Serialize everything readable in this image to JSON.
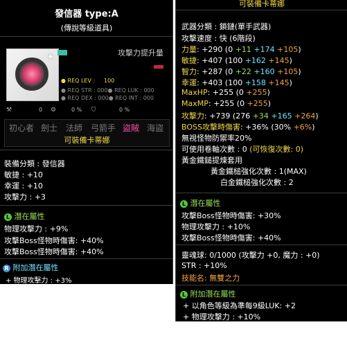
{
  "left": {
    "title": "發信器 type:A",
    "subtitle": "(傳說等級道具)",
    "attack_up": "攻擊力提升量",
    "req": {
      "lev_label": "● REQ LEV :",
      "lev_value": "100",
      "str": "● REQ STR : 000● REQ LUK : 000",
      "dex": "● REQ DEX : 000● REQ INT : 000"
    },
    "icon_row": [
      "0",
      "0 %",
      "0 %"
    ],
    "jobs": [
      "初心者",
      "劍士",
      "法師",
      "弓箭手",
      "盜賊",
      "海盜"
    ],
    "usable": "可裝備卡蒂娜",
    "stats": {
      "category": "裝備分類 : 發信器",
      "dex": "敏捷 : +10",
      "luk": "幸運 : +10",
      "atk": "攻擊力 : +3"
    },
    "potential": {
      "label": "潛在屬性",
      "lines": [
        "物理攻擊力 : +9%",
        "攻擊Boss怪物時傷害: +40%",
        "攻擊Boss怪物時傷害: +40%"
      ]
    },
    "additional": {
      "label": "附加潛在屬性",
      "lines": [
        "+ 物理攻擊力 : +3%"
      ]
    }
  },
  "right": {
    "top_usable": "可裝備卡蒂娜",
    "weapon_class": "武器分類 : 鎖鏈(單手武器)",
    "attack_speed": "攻擊速度 : 快 (6階段)",
    "str": {
      "label": "力量",
      "rest": ": +290 (0 ",
      "a": "+11",
      "b": "+174",
      "c": "+105",
      "end": ")"
    },
    "dex": {
      "label": "敏捷",
      "rest": ": +407 (100 ",
      "a": "+162",
      "b": "+145",
      "end": ")"
    },
    "int": {
      "label": "智力",
      "rest": ": +287 (0 ",
      "a": "+22",
      "b": "+160",
      "c": "+105",
      "end": ")"
    },
    "luk": {
      "label": "幸運",
      "rest": ": +403 (100 ",
      "a": "+158",
      "b": "+145",
      "end": ")"
    },
    "maxhp": {
      "label": "MaxHP",
      "rest": ": +255 (0 ",
      "a": "+255",
      "end": ")"
    },
    "maxmp": {
      "label": "MaxMP",
      "rest": ": +255 (0 ",
      "a": "+255",
      "end": ")"
    },
    "atk": {
      "label": "攻擊力",
      "rest": ": +739 (276 ",
      "a": "+34",
      "b": "+165",
      "c": "+264",
      "end": ")"
    },
    "boss": {
      "label": "BOSS攻擊時傷害",
      "rest": ": +36% (30% ",
      "a": "+6%",
      "end": ")"
    },
    "ignore_def": "無視怪物防禦率20%",
    "upgrades": "可使用卷軸次數 : 0",
    "recover": "(可恢復次數: 0)",
    "golden_hammer": "黃金鐵鎚提煉套用",
    "golden_max": "黃金鐵槌強化次數 : 1(MAX)",
    "white_count": "白金鐵槌強化次數 : 2",
    "potential": {
      "label": "潛在屬性",
      "lines": [
        "攻擊Boss怪物時傷害: +30%",
        "物理攻擊力 : +10%",
        "攻擊Boss怪物時傷害: +40%"
      ]
    },
    "soul": {
      "gauge": "靈魂球: 0/1000 (攻擊力 +0, 魔力 : +0)",
      "str": "STR : +10%",
      "skill": "技能名: 無雙之力"
    },
    "additional": {
      "label": "附加潛在屬性",
      "lines": [
        "+ 以角色等級為準每9級LUK: +2",
        "+ 物理攻擊力 : +10%"
      ]
    }
  },
  "colors": {
    "yellow": "#f0d84a",
    "orange": "#f2a340",
    "green": "#9be050",
    "cyan": "#6fe3ff",
    "pink": "#ff4fa6"
  }
}
